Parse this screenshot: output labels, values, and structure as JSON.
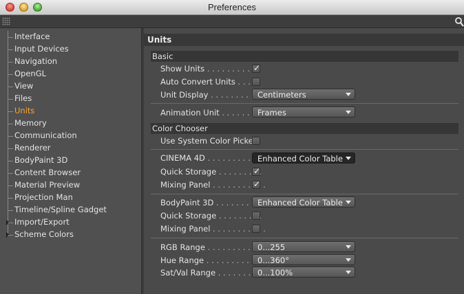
{
  "window": {
    "title": "Preferences"
  },
  "sidebar": {
    "items": [
      {
        "label": "Interface"
      },
      {
        "label": "Input Devices"
      },
      {
        "label": "Navigation"
      },
      {
        "label": "OpenGL"
      },
      {
        "label": "View"
      },
      {
        "label": "Files"
      },
      {
        "label": "Units",
        "active": true
      },
      {
        "label": "Memory"
      },
      {
        "label": "Communication"
      },
      {
        "label": "Renderer"
      },
      {
        "label": "BodyPaint 3D"
      },
      {
        "label": "Content Browser"
      },
      {
        "label": "Material Preview"
      },
      {
        "label": "Projection Man"
      },
      {
        "label": "Timeline/Spline Gadget"
      },
      {
        "label": "Import/Export",
        "expandable": true
      },
      {
        "label": "Scheme Colors",
        "expandable": true
      }
    ],
    "active_color": "#ffa622"
  },
  "content": {
    "title": "Units",
    "basic": {
      "header": "Basic",
      "show_units": {
        "label": "Show Units",
        "dots": " . . . . . . . . . . .",
        "checked": true
      },
      "auto_convert": {
        "label": "Auto Convert Units",
        "dots": " . . . .",
        "checked": false
      },
      "unit_display": {
        "label": "Unit Display",
        "dots": " . . . . . . . . . . .",
        "value": "Centimeters"
      },
      "animation_unit": {
        "label": "Animation Unit",
        "dots": " . . . . . . . .",
        "value": "Frames"
      }
    },
    "color_chooser": {
      "header": "Color Chooser",
      "use_system": {
        "label": "Use System Color Picker",
        "checked": false
      },
      "cinema4d": {
        "label": "CINEMA 4D",
        "dots": " . . . . . . . . . . .",
        "value": "Enhanced Color Table"
      },
      "c4d_quick_storage": {
        "label": "Quick Storage",
        "dots": " . . . . . . . . .",
        "checked": true
      },
      "c4d_mixing_panel": {
        "label": "Mixing Panel",
        "dots": " . . . . . . . . . . .",
        "checked": true
      },
      "bodypaint": {
        "label": "BodyPaint 3D",
        "dots": " . . . . . . . .",
        "value": "Enhanced Color Table"
      },
      "bp_quick_storage": {
        "label": "Quick Storage",
        "dots": " . . . . . . . . .",
        "checked": false
      },
      "bp_mixing_panel": {
        "label": "Mixing Panel",
        "dots": " . . . . . . . . . . .",
        "checked": false
      },
      "rgb_range": {
        "label": "RGB Range",
        "dots": " . . . . . . . . . . . .",
        "value": "0...255"
      },
      "hue_range": {
        "label": "Hue Range",
        "dots": " . . . . . . . . . . . .",
        "value": "0...360°"
      },
      "satval_range": {
        "label": "Sat/Val Range",
        "dots": " . . . . . . . . . .",
        "value": "0...100%"
      }
    },
    "checkmark_glyph": "✓"
  }
}
